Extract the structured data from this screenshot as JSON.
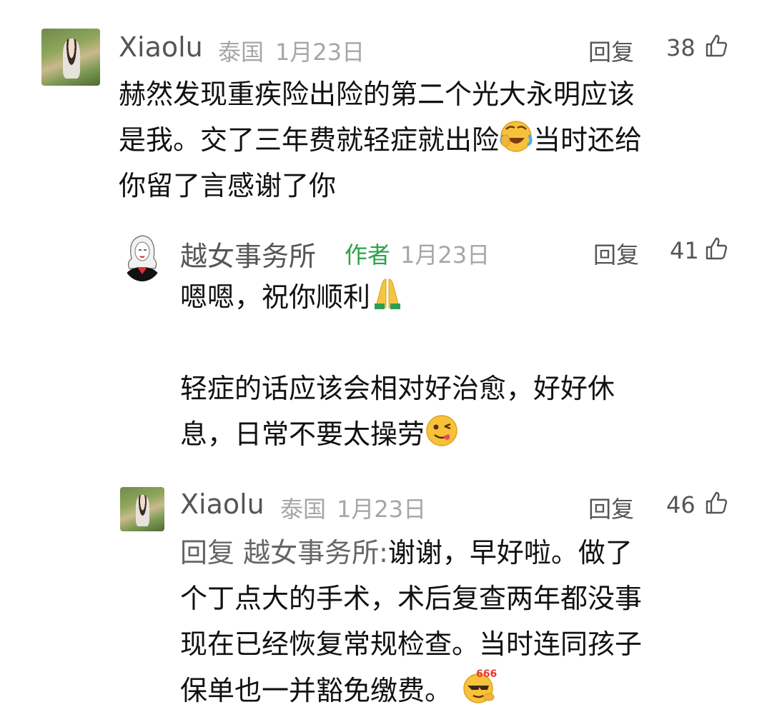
{
  "comments": [
    {
      "name": "Xiaolu",
      "location": "泰国",
      "date": "1月23日",
      "reply_label": "回复",
      "likes": "38",
      "text_parts": [
        "赫然发现重疾险出险的第二个光大永明应该",
        "是我。交了三年费就轻症就出险",
        "当时还给",
        "你留了言感谢了你"
      ],
      "emoji": "crying-laughing-emoji"
    },
    {
      "name": "越女事务所",
      "author_tag": "作者",
      "date": "1月23日",
      "reply_label": "回复",
      "likes": "41",
      "line1": "嗯嗯，祝你顺利",
      "line1_emoji": "praying-hands-emoji",
      "line2": "轻症的话应该会相对好治愈，好好休",
      "line3": "息，日常不要太操劳",
      "line3_emoji": "winking-tongue-emoji"
    },
    {
      "name": "Xiaolu",
      "location": "泰国",
      "date": "1月23日",
      "reply_label": "回复",
      "likes": "46",
      "reply_prefix": "回复 越女事务所:",
      "l1": "谢谢，早好啦。做了",
      "l2": "个丁点大的手术，术后复查两年都没事",
      "l3": "现在已经恢复常规检查。当时连同孩子",
      "l4": "保单也一并豁免缴费。",
      "emoji_badge": "666",
      "emoji": "cool-666-emoji"
    }
  ],
  "colors": {
    "author": "#27a349",
    "meta": "#a6a6a6",
    "text": "#111111"
  }
}
